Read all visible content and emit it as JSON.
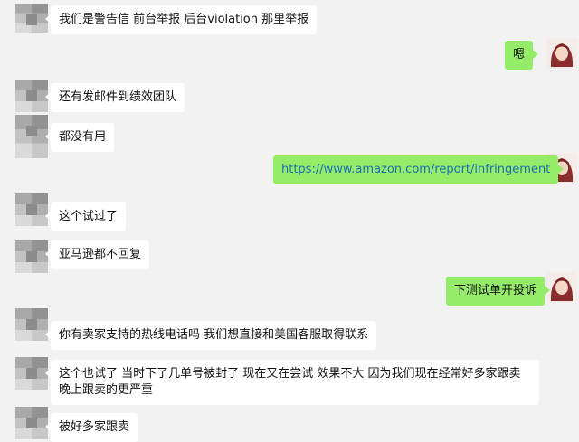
{
  "chat": {
    "messages": [
      {
        "side": "left",
        "text": "我们是警告信 前台举报 后台violation 那里举报"
      },
      {
        "side": "right",
        "text": "嗯"
      },
      {
        "side": "left",
        "text": "还有发邮件到绩效团队"
      },
      {
        "side": "left",
        "text": "都没有用"
      },
      {
        "side": "right",
        "text": "https://www.amazon.com/report/infringement"
      },
      {
        "side": "left",
        "text": "这个试过了"
      },
      {
        "side": "left",
        "text": "亚马逊都不回复"
      },
      {
        "side": "right",
        "text": "下测试单开投诉"
      },
      {
        "side": "left",
        "text": "你有卖家支持的热线电话吗 我们想直接和美国客服取得联系"
      },
      {
        "side": "left",
        "text": "这个也试了 当时下了几单号被封了 现在又在尝试 效果不大 因为我们现在经常好多家跟卖 晚上跟卖的更严重"
      },
      {
        "side": "left",
        "text": "被好多家跟卖"
      }
    ]
  },
  "colors": {
    "background": "#f2f2f2",
    "left_bubble": "#ffffff",
    "right_bubble": "#95ec69",
    "link": "#1a6fb3"
  }
}
